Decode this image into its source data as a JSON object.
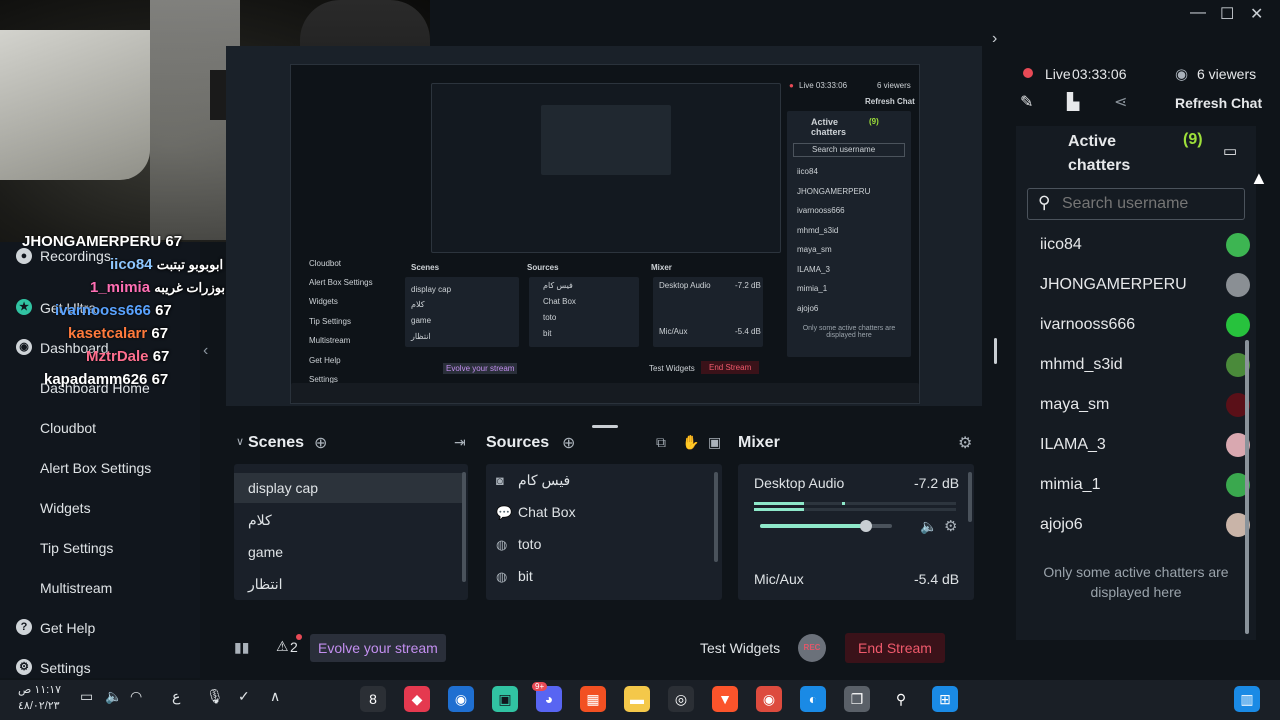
{
  "sidebar": {
    "items": [
      {
        "label": "Recordings",
        "icon": "recordings-icon"
      },
      {
        "label": "Get Ultra",
        "icon": "ultra-icon"
      },
      {
        "label": "Dashboard",
        "icon": "dashboard-icon"
      },
      {
        "label": "Dashboard Home"
      },
      {
        "label": "Cloudbot"
      },
      {
        "label": "Alert Box Settings"
      },
      {
        "label": "Widgets"
      },
      {
        "label": "Tip Settings"
      },
      {
        "label": "Multistream"
      },
      {
        "label": "Get Help",
        "icon": "help-icon"
      },
      {
        "label": "Settings",
        "icon": "settings-icon"
      }
    ]
  },
  "chat_overlay": [
    {
      "name": "JHONGAMERPERU",
      "count": "67",
      "color": "#ffffff"
    },
    {
      "name": "iico84",
      "message": "ابوبوبو تبتبت",
      "color": "#8ec7ff"
    },
    {
      "name": "1_mimia",
      "message": "شكله بوت بوزرات غريبه",
      "color": "#ff6fb4"
    },
    {
      "name": "ivarnooss666",
      "count": "67",
      "color": "#5aa3ff"
    },
    {
      "name": "kasetcalarr",
      "count": "67",
      "color": "#ff7a3c"
    },
    {
      "name": "MztrDale",
      "count": "67",
      "color": "#ff6f8e"
    },
    {
      "name": "kapadamm626",
      "count": "67",
      "color": "#ffffff"
    }
  ],
  "preview": {
    "inner_scenes_title": "Scenes",
    "inner_sources_title": "Sources",
    "inner_mixer_title": "Mixer",
    "inner_scenes": [
      "display cap",
      "كلام",
      "game",
      "انتظار"
    ],
    "inner_sources": [
      "فيس كام",
      "Chat Box",
      "toto",
      "bit"
    ],
    "inner_desktop_audio": "Desktop Audio",
    "inner_desktop_db": "-7.2 dB",
    "inner_mic": "Mic/Aux",
    "inner_mic_db": "-5.4 dB",
    "inner_evolve": "Evolve your stream",
    "inner_test_widgets": "Test Widgets",
    "inner_end_stream": "End Stream",
    "inner_live": "Live 03:33:06",
    "inner_viewers": "6 viewers",
    "inner_refresh": "Refresh Chat",
    "inner_active": "Active chatters",
    "inner_active_count": "(9)",
    "inner_search": "Search username",
    "inner_chatters": [
      "iico84",
      "JHONGAMERPERU",
      "ivarnooss666",
      "mhmd_s3id",
      "maya_sm",
      "ILAMA_3",
      "mimia_1",
      "ajojo6"
    ],
    "inner_note": "Only some active chatters are displayed here",
    "inner_sidebar": [
      "Cloudbot",
      "Alert Box Settings",
      "Widgets",
      "Tip Settings",
      "Multistream",
      "Get Help",
      "Settings"
    ]
  },
  "dock": {
    "scenes_title": "Scenes",
    "sources_title": "Sources",
    "mixer_title": "Mixer",
    "scenes": [
      "display cap",
      "كلام",
      "game",
      "انتظار"
    ],
    "selected_scene": 0,
    "sources": [
      {
        "label": "فيس كام",
        "icon": "webcam-icon"
      },
      {
        "label": "Chat Box",
        "icon": "chat-icon"
      },
      {
        "label": "toto",
        "icon": "globe-icon"
      },
      {
        "label": "bit",
        "icon": "globe-icon"
      }
    ],
    "mixer": [
      {
        "name": "Desktop Audio",
        "db": "-7.2 dB",
        "volume": 0.8
      },
      {
        "name": "Mic/Aux",
        "db": "-5.4 dB"
      }
    ]
  },
  "footer": {
    "warnings": "2",
    "evolve": "Evolve your stream",
    "test_widgets": "Test Widgets",
    "rec": "REC",
    "end_stream": "End Stream"
  },
  "right_panel": {
    "live_label": "Live",
    "live_time": "03:33:06",
    "viewers": "6 viewers",
    "refresh": "Refresh Chat",
    "active_title": "Active chatters",
    "active_count": "(9)",
    "search_placeholder": "Search username",
    "chatters": [
      {
        "name": "iico84",
        "color": "#3db552"
      },
      {
        "name": "JHONGAMERPERU",
        "color": "#8a8f94"
      },
      {
        "name": "ivarnooss666",
        "color": "#27c23d"
      },
      {
        "name": "mhmd_s3id",
        "color": "#4a8a3a"
      },
      {
        "name": "maya_sm",
        "color": "#5a1018"
      },
      {
        "name": "ILAMA_3",
        "color": "#d9a8b0"
      },
      {
        "name": "mimia_1",
        "color": "#3aa84e"
      },
      {
        "name": "ajojo6",
        "color": "#c9b4a8"
      }
    ],
    "note": "Only some active chatters are displayed here"
  },
  "taskbar": {
    "time": "١١:١٧ ص",
    "date": "٤٨/٠٢/٢٣",
    "lang": "ع",
    "discord_badge": "9+"
  },
  "colors": {
    "accent_green": "#31c3a2",
    "active_count": "#9ee03a",
    "live": "#e84a56",
    "evolve_text": "#c38ff0",
    "end_stream": "#f05a6c"
  }
}
